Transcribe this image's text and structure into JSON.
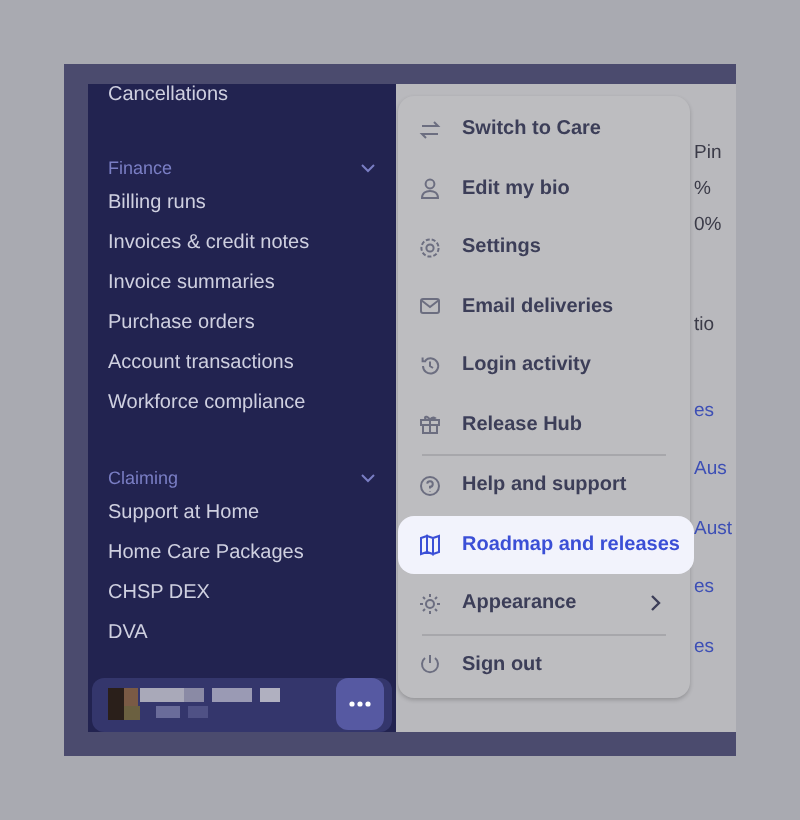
{
  "sidebar": {
    "items": [
      {
        "kind": "item",
        "label": "Cancellations"
      },
      {
        "kind": "header",
        "label": "Finance",
        "expanded": true
      },
      {
        "kind": "item",
        "label": "Billing runs"
      },
      {
        "kind": "item",
        "label": "Invoices & credit notes"
      },
      {
        "kind": "item",
        "label": "Invoice summaries"
      },
      {
        "kind": "item",
        "label": "Purchase orders"
      },
      {
        "kind": "item",
        "label": "Account transactions"
      },
      {
        "kind": "item",
        "label": "Workforce compliance"
      },
      {
        "kind": "header",
        "label": "Claiming",
        "expanded": true
      },
      {
        "kind": "item",
        "label": "Support at Home"
      },
      {
        "kind": "item",
        "label": "Home Care Packages"
      },
      {
        "kind": "item",
        "label": "CHSP DEX"
      },
      {
        "kind": "item",
        "label": "DVA"
      }
    ]
  },
  "content": {
    "fragments": [
      {
        "kind": "stat",
        "text": "Pin"
      },
      {
        "kind": "stat",
        "text": "%"
      },
      {
        "kind": "stat",
        "text": "0%"
      },
      {
        "kind": "label",
        "text": "tio"
      },
      {
        "kind": "link",
        "text": "es"
      },
      {
        "kind": "link",
        "text": "Aus"
      },
      {
        "kind": "link",
        "text": "Aust"
      },
      {
        "kind": "link",
        "text": "es"
      },
      {
        "kind": "link",
        "text": "es"
      }
    ]
  },
  "menu": {
    "items": [
      {
        "label": "Switch to Care",
        "selected": false,
        "submenu": false,
        "divider_after": false
      },
      {
        "label": "Edit my bio",
        "selected": false,
        "submenu": false,
        "divider_after": false
      },
      {
        "label": "Settings",
        "selected": false,
        "submenu": false,
        "divider_after": false
      },
      {
        "label": "Email deliveries",
        "selected": false,
        "submenu": false,
        "divider_after": false
      },
      {
        "label": "Login activity",
        "selected": false,
        "submenu": false,
        "divider_after": false
      },
      {
        "label": "Release Hub",
        "selected": false,
        "submenu": false,
        "divider_after": true
      },
      {
        "label": "Help and support",
        "selected": false,
        "submenu": false,
        "divider_after": false
      },
      {
        "label": "Roadmap and releases",
        "selected": true,
        "submenu": false,
        "divider_after": false
      },
      {
        "label": "Appearance",
        "selected": false,
        "submenu": true,
        "divider_after": true
      },
      {
        "label": "Sign out",
        "selected": false,
        "submenu": false,
        "divider_after": false
      }
    ]
  }
}
